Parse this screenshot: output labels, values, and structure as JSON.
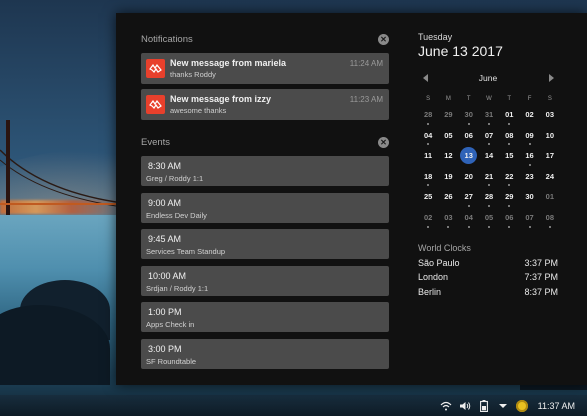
{
  "notifications": {
    "heading": "Notifications",
    "items": [
      {
        "title": "New message from mariela",
        "body": "thanks Roddy",
        "time": "11:24 AM"
      },
      {
        "title": "New message from izzy",
        "body": "awesome thanks",
        "time": "11:23 AM"
      }
    ]
  },
  "events": {
    "heading": "Events",
    "items": [
      {
        "time": "8:30 AM",
        "title": "Greg / Roddy 1:1"
      },
      {
        "time": "9:00 AM",
        "title": "Endless Dev Daily"
      },
      {
        "time": "9:45 AM",
        "title": "Services Team Standup"
      },
      {
        "time": "10:00 AM",
        "title": "Srdjan / Roddy 1:1"
      },
      {
        "time": "1:00 PM",
        "title": "Apps Check in"
      },
      {
        "time": "3:00 PM",
        "title": "SF Roundtable"
      }
    ]
  },
  "calendar": {
    "weekday": "Tuesday",
    "date": "June 13 2017",
    "month": "June",
    "headers": [
      "S",
      "M",
      "T",
      "W",
      "T",
      "F",
      "S"
    ],
    "weeks": [
      [
        "28",
        "29",
        "30",
        "31",
        "01",
        "02",
        "03"
      ],
      [
        "04",
        "05",
        "06",
        "07",
        "08",
        "09",
        "10"
      ],
      [
        "11",
        "12",
        "13",
        "14",
        "15",
        "16",
        "17"
      ],
      [
        "18",
        "19",
        "20",
        "21",
        "22",
        "23",
        "24"
      ],
      [
        "25",
        "26",
        "27",
        "28",
        "29",
        "30",
        "01"
      ],
      [
        "02",
        "03",
        "04",
        "05",
        "06",
        "07",
        "08"
      ]
    ]
  },
  "world_clocks": {
    "heading": "World Clocks",
    "items": [
      {
        "city": "São Paulo",
        "time": "3:37 PM"
      },
      {
        "city": "London",
        "time": "7:37 PM"
      },
      {
        "city": "Berlin",
        "time": "8:37 PM"
      }
    ]
  },
  "taskbar": {
    "clock": "11:37 AM"
  },
  "colors": {
    "accent": "#2f63b8",
    "app_icon": "#e8402c",
    "card": "#4b4b4b",
    "panel": "#111111"
  }
}
